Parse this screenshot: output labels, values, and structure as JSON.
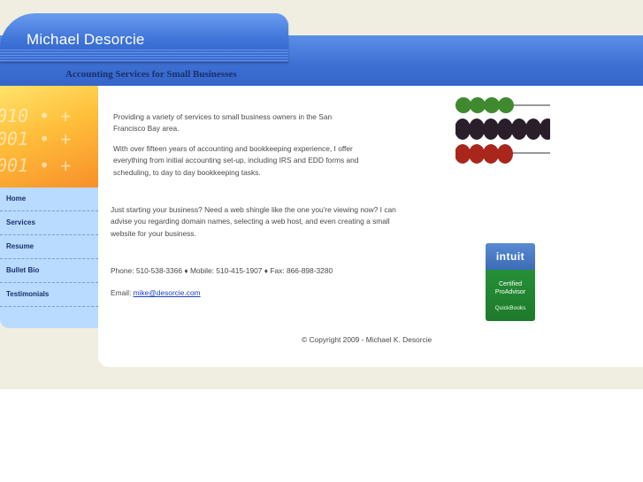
{
  "header": {
    "site_name": "Michael Desorcie",
    "tagline": "Accounting Services for Small Businesses"
  },
  "sidebar": {
    "photo_digits": [
      "010 •  +",
      "001 •  +",
      "001 •  +"
    ],
    "items": [
      {
        "label": "Home"
      },
      {
        "label": "Services"
      },
      {
        "label": "Resume"
      },
      {
        "label": "Bullet Bio"
      },
      {
        "label": "Testimonials"
      }
    ]
  },
  "main": {
    "para1": "Providing a variety of services to small business owners in the San Francisco Bay area.",
    "para2": "With over fifteen years of accounting and bookkeeping experience, I offer everything from initial accounting set-up, including IRS and EDD forms and scheduling, to day to day bookkeeping tasks.",
    "para3": "Just starting your business?  Need a web shingle like the one you're viewing now? I can advise you regarding domain names, selecting a web host, and even creating a small website for your business.",
    "contact": "Phone: 510-538-3366 ♦ Mobile: 510-415-1907 ♦ Fax: 866-898-3280",
    "email_label": "Email: ",
    "email": "mike@desorcie.com",
    "copyright": "© Copyright 2009 - Michael K. Desorcie"
  },
  "badge": {
    "brand": "intuit",
    "line1": "Certified",
    "line2": "ProAdvisor",
    "line3": "QuickBooks"
  },
  "colors": {
    "header_blue": "#3d6fd3",
    "nav_bg": "#b9dbff",
    "nav_text": "#1b2f6b",
    "page_bg": "#efeee0"
  }
}
